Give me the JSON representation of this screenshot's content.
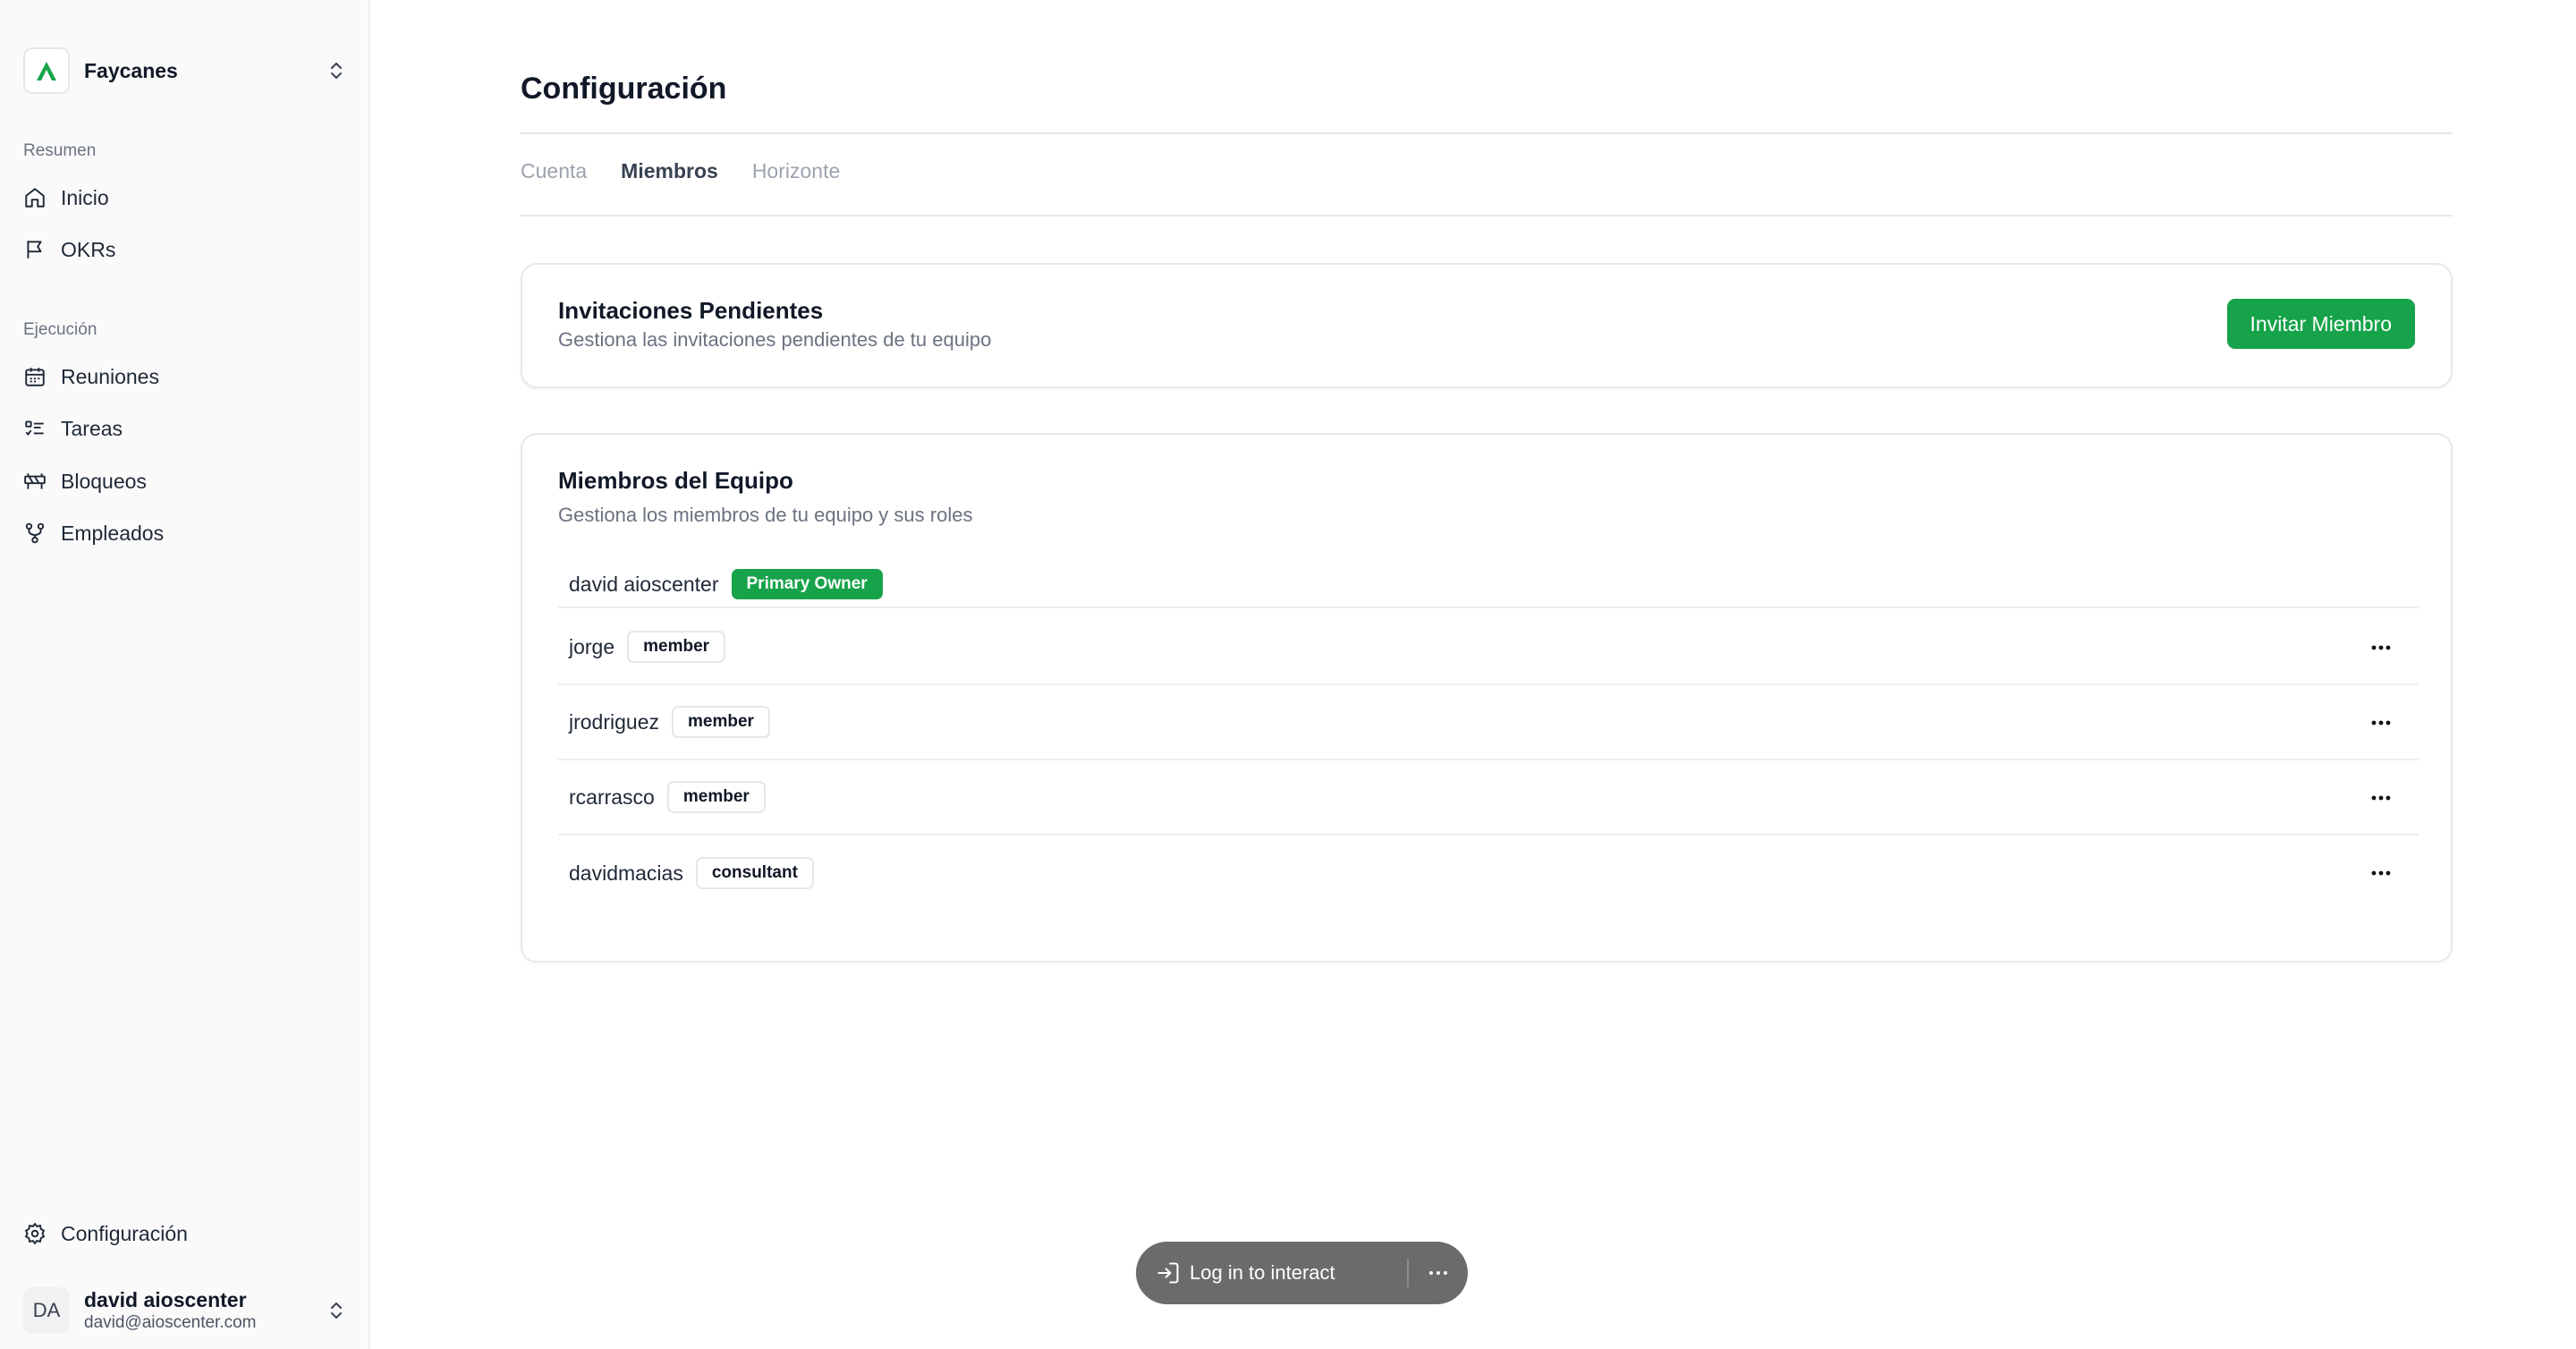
{
  "sidebar": {
    "workspace": {
      "name": "Faycanes",
      "logo_icon": "faycanes-logo-icon",
      "logo_color": "#16a34a"
    },
    "groups": [
      {
        "title": "Resumen",
        "items": [
          {
            "label": "Inicio",
            "icon": "home-icon"
          },
          {
            "label": "OKRs",
            "icon": "flag-icon"
          }
        ]
      },
      {
        "title": "Ejecución",
        "items": [
          {
            "label": "Reuniones",
            "icon": "calendar-icon"
          },
          {
            "label": "Tareas",
            "icon": "task-list-icon"
          },
          {
            "label": "Bloqueos",
            "icon": "roadblock-icon"
          },
          {
            "label": "Empleados",
            "icon": "org-chart-icon"
          }
        ]
      }
    ],
    "settings_label": "Configuración",
    "user": {
      "initials": "DA",
      "name": "david aioscenter",
      "email": "david@aioscenter.com"
    }
  },
  "main": {
    "title": "Configuración",
    "tabs": [
      {
        "label": "Cuenta",
        "active": false
      },
      {
        "label": "Miembros",
        "active": true
      },
      {
        "label": "Horizonte",
        "active": false
      }
    ],
    "invitations": {
      "title": "Invitaciones Pendientes",
      "subtitle": "Gestiona las invitaciones pendientes de tu equipo",
      "button_label": "Invitar Miembro"
    },
    "members": {
      "title": "Miembros del Equipo",
      "subtitle": "Gestiona los miembros de tu equipo y sus roles",
      "rows": [
        {
          "name": "david aioscenter",
          "role": "Primary Owner"
        },
        {
          "name": "jorge",
          "role": "member"
        },
        {
          "name": "jrodriguez",
          "role": "member"
        },
        {
          "name": "rcarrasco",
          "role": "member"
        },
        {
          "name": "davidmacias",
          "role": "consultant"
        }
      ]
    }
  },
  "overlay": {
    "login_label": "Log in to interact"
  },
  "colors": {
    "accent": "#16a34a",
    "pill_bg": "#6b6b6b"
  }
}
